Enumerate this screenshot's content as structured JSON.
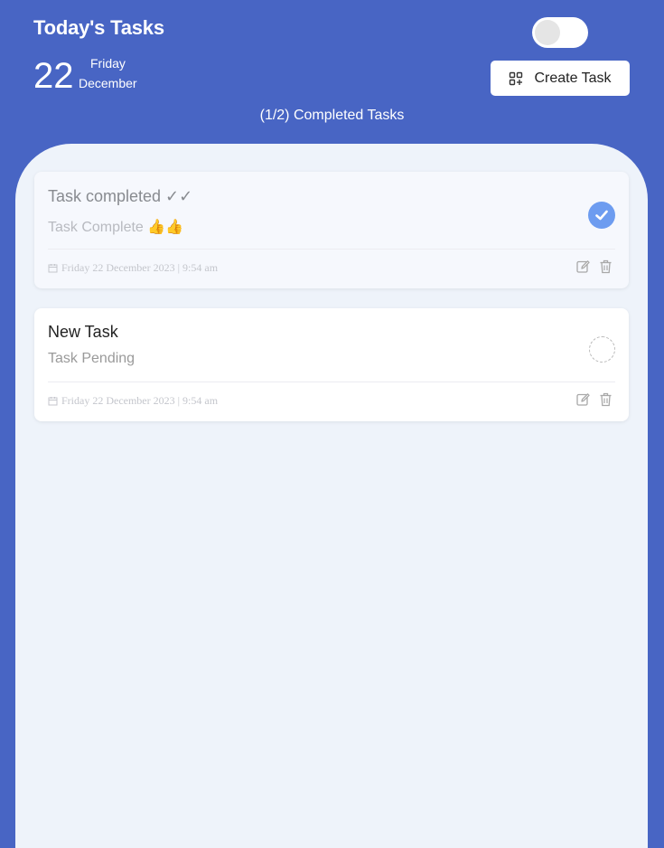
{
  "header": {
    "title": "Today's Tasks",
    "day": "22",
    "weekday": "Friday",
    "month": "December",
    "create_label": "Create Task",
    "progress": "(1/2) Completed Tasks",
    "toggle_on": false
  },
  "colors": {
    "background": "#4865c4",
    "panel": "#eef3fa",
    "check_done": "#6d9cf0"
  },
  "tasks": [
    {
      "title": "Task completed ✓✓",
      "subtitle": "Task Complete 👍👍",
      "date": "Friday 22 December 2023 | 9:54 am",
      "completed": true
    },
    {
      "title": "New Task",
      "subtitle": "Task Pending",
      "date": "Friday 22 December 2023 | 9:54 am",
      "completed": false
    }
  ]
}
